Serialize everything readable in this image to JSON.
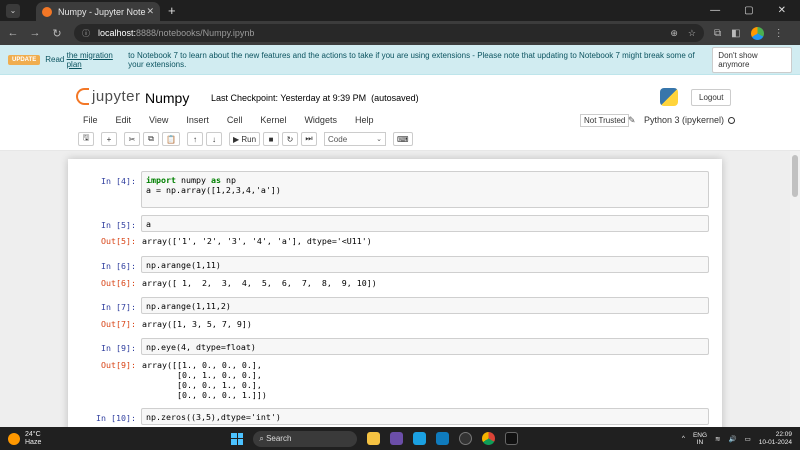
{
  "browser": {
    "tab_title": "Numpy - Jupyter Notebook",
    "url_host": "localhost:",
    "url_path": "8888/notebooks/Numpy.ipynb"
  },
  "banner": {
    "badge": "UPDATE",
    "text_before": "Read",
    "link_text": "the migration plan",
    "text_after": "to Notebook 7 to learn about the new features and the actions to take if you are using extensions - Please note that updating to Notebook 7 might break some of your extensions.",
    "dismiss_label": "Don't show anymore"
  },
  "header": {
    "logo_text": "jupyter",
    "notebook_name": "Numpy",
    "checkpoint_label": "Last Checkpoint:",
    "checkpoint_time": "Yesterday at 9:39 PM",
    "save_status": "(autosaved)",
    "logout_label": "Logout"
  },
  "menu": {
    "items": [
      "File",
      "Edit",
      "View",
      "Insert",
      "Cell",
      "Kernel",
      "Widgets",
      "Help"
    ],
    "trusted_label": "Not Trusted",
    "kernel_label": "Python 3 (ipykernel)"
  },
  "toolbar": {
    "run_label": "Run",
    "cell_type": "Code"
  },
  "cells": {
    "c1": {
      "prompt": "In [4]:",
      "line1_kw1": "import",
      "line1_mid": " numpy ",
      "line1_kw2": "as",
      "line1_end": " np",
      "line2": "a = np.array([1,2,3,4,'a'])"
    },
    "c2": {
      "prompt": "In [5]:",
      "code": "a",
      "out_prompt": "Out[5]:",
      "output": "array(['1', '2', '3', '4', 'a'], dtype='<U11')"
    },
    "c3": {
      "prompt": "In [6]:",
      "code": "np.arange(1,11)",
      "out_prompt": "Out[6]:",
      "output": "array([ 1,  2,  3,  4,  5,  6,  7,  8,  9, 10])"
    },
    "c4": {
      "prompt": "In [7]:",
      "code": "np.arange(1,11,2)",
      "out_prompt": "Out[7]:",
      "output": "array([1, 3, 5, 7, 9])"
    },
    "c5": {
      "prompt": "In [9]:",
      "code": "np.eye(4, dtype=float)",
      "out_prompt": "Out[9]:",
      "output": "array([[1., 0., 0., 0.],\n       [0., 1., 0., 0.],\n       [0., 0., 1., 0.],\n       [0., 0., 0., 1.]])"
    },
    "c6": {
      "prompt": "In [10]:",
      "code": "np.zeros((3,5),dtype='int')"
    }
  },
  "taskbar": {
    "temperature": "24°C",
    "weather": "Haze",
    "search_label": "Search",
    "lang_top": "ENG",
    "lang_bottom": "IN",
    "time": "22:09",
    "date": "10-01-2024"
  }
}
